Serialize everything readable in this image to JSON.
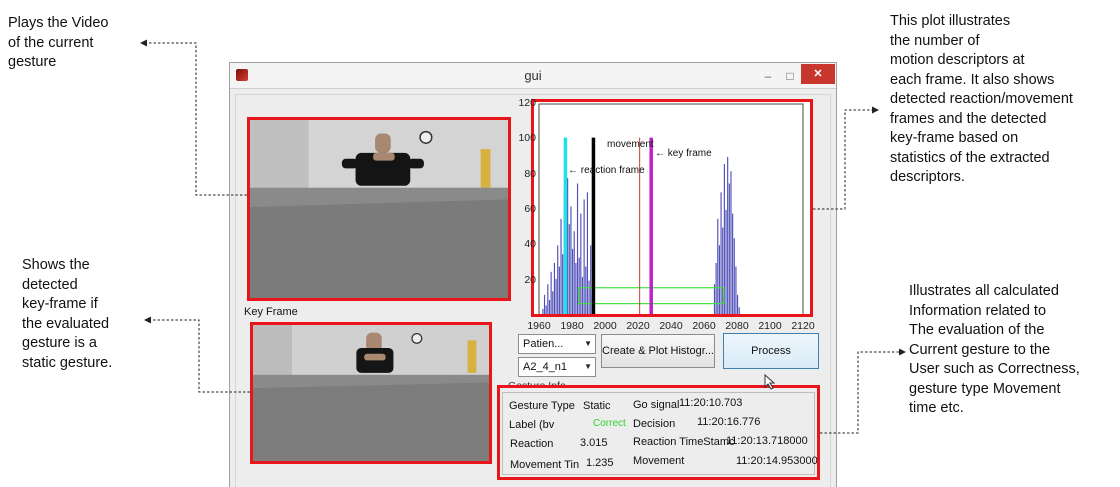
{
  "callouts": {
    "video": "Plays the Video\nof the current\ngesture",
    "plot": "This plot illustrates\nthe number of\nmotion descriptors at\neach frame. It also shows\ndetected reaction/movement\nframes and the detected\nkey-frame based on\nstatistics of the extracted\ndescriptors.",
    "keyframe": "Shows the\ndetected\nkey-frame if\nthe evaluated\ngesture is a\nstatic gesture.",
    "info": "Illustrates all calculated\nInformation related to\nThe evaluation of the\nCurrent gesture to the\nUser such as Correctness,\ngesture type Movement\ntime etc."
  },
  "window": {
    "title": "gui",
    "minimize": "–",
    "maximize": "□",
    "close": "✕",
    "app_icon": "matlab-icon"
  },
  "key_frame_label": "Key Frame",
  "plot_annotations": {
    "movement": "movement",
    "reaction": "← reaction frame",
    "key_frame": "← key frame"
  },
  "controls": {
    "patient_select": "Patien...",
    "gesture_select": "A2_4_n1",
    "create_plot_button": "Create & Plot Histogr...",
    "process_button": "Process"
  },
  "gesture_info": {
    "title": "Gesture Info.",
    "gesture_type_label": "Gesture Type",
    "gesture_type_value": "Static",
    "label_label": "Label (bv",
    "label_value": "Correct",
    "reaction_label": "Reaction",
    "reaction_value": "3.015",
    "movement_time_label": "Movement Tin",
    "movement_time_value": "1.235",
    "go_signal_label": "Go signal",
    "go_signal_value": "11:20:10.703",
    "decision_label": "Decision",
    "decision_value": "11:20:16.776",
    "reaction_ts_label": "Reaction TimeStamc",
    "reaction_ts_value": "11:20:13.718000",
    "movement_label": "Movement",
    "movement_value": "11:20:14.953000"
  },
  "colors": {
    "highlight": "#e8161b",
    "bars": "#5050b8",
    "reaction_line": "#22e0e8",
    "movement_line": "#000000",
    "key_line": "#c020c8",
    "thin_line": "#c04040",
    "box_line": "#40e040",
    "correct": "#2fd12f"
  },
  "chart_data": {
    "type": "bar",
    "xlim": [
      1960,
      2120
    ],
    "ylim": [
      0,
      120
    ],
    "xticks": [
      1960,
      1980,
      2000,
      2020,
      2040,
      2060,
      2080,
      2100,
      2120
    ],
    "yticks": [
      20,
      40,
      60,
      80,
      100,
      120
    ],
    "grid": false,
    "markers": {
      "reaction_frame": 1976,
      "movement_frame": 1993,
      "key_frame": 2028,
      "thin_line": 2021
    },
    "range_box": {
      "x": [
        1984,
        2072
      ],
      "y": [
        7,
        16
      ]
    },
    "bars": [
      [
        1962,
        4
      ],
      [
        1963,
        12
      ],
      [
        1964,
        6
      ],
      [
        1965,
        18
      ],
      [
        1966,
        9
      ],
      [
        1967,
        25
      ],
      [
        1968,
        14
      ],
      [
        1969,
        30
      ],
      [
        1970,
        21
      ],
      [
        1971,
        40
      ],
      [
        1972,
        28
      ],
      [
        1973,
        55
      ],
      [
        1974,
        35
      ],
      [
        1975,
        70
      ],
      [
        1976,
        45
      ],
      [
        1977,
        78
      ],
      [
        1978,
        52
      ],
      [
        1979,
        62
      ],
      [
        1980,
        38
      ],
      [
        1981,
        48
      ],
      [
        1982,
        30
      ],
      [
        1983,
        75
      ],
      [
        1984,
        33
      ],
      [
        1985,
        58
      ],
      [
        1986,
        22
      ],
      [
        1987,
        66
      ],
      [
        1988,
        28
      ],
      [
        1989,
        70
      ],
      [
        1990,
        20
      ],
      [
        1991,
        40
      ],
      [
        1992,
        12
      ],
      [
        1993,
        8
      ],
      [
        2066,
        18
      ],
      [
        2067,
        30
      ],
      [
        2068,
        55
      ],
      [
        2069,
        40
      ],
      [
        2070,
        70
      ],
      [
        2071,
        50
      ],
      [
        2072,
        86
      ],
      [
        2073,
        60
      ],
      [
        2074,
        90
      ],
      [
        2075,
        75
      ],
      [
        2076,
        82
      ],
      [
        2077,
        58
      ],
      [
        2078,
        44
      ],
      [
        2079,
        28
      ],
      [
        2080,
        12
      ],
      [
        2081,
        5
      ]
    ]
  }
}
